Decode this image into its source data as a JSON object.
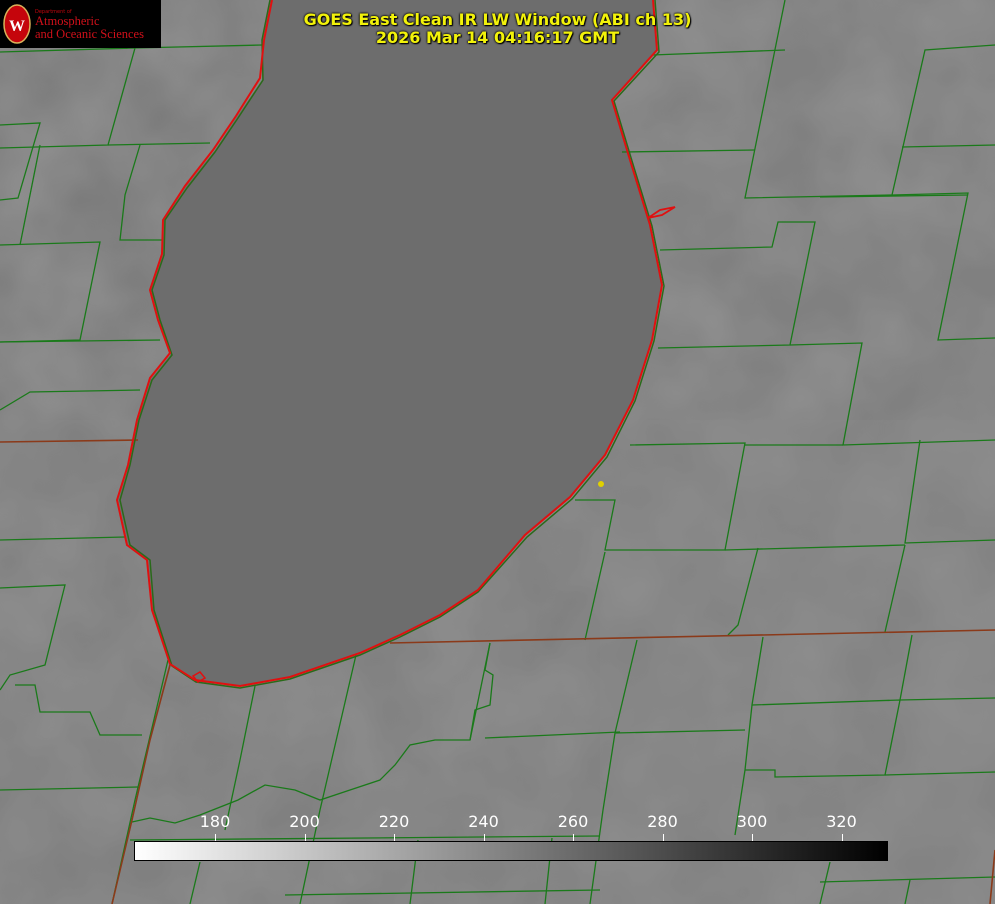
{
  "header": {
    "title_line1": "GOES East Clean IR LW Window (ABI ch 13)",
    "title_line2": "2026 Mar 14 04:16:17 GMT"
  },
  "logo": {
    "department": "Department of",
    "line1": "Atmospheric",
    "line2": "and Oceanic Sciences"
  },
  "colorbar": {
    "ticks": [
      "180",
      "200",
      "220",
      "240",
      "260",
      "280",
      "300",
      "320"
    ],
    "start_color": "#ffffff",
    "end_color": "#000000"
  },
  "colors": {
    "county_lines": "#1a7a1a",
    "state_lines": "#8b3a1a",
    "lake_outline": "#e01010",
    "title_text": "#f2f20a",
    "marker": "#e0d000"
  }
}
